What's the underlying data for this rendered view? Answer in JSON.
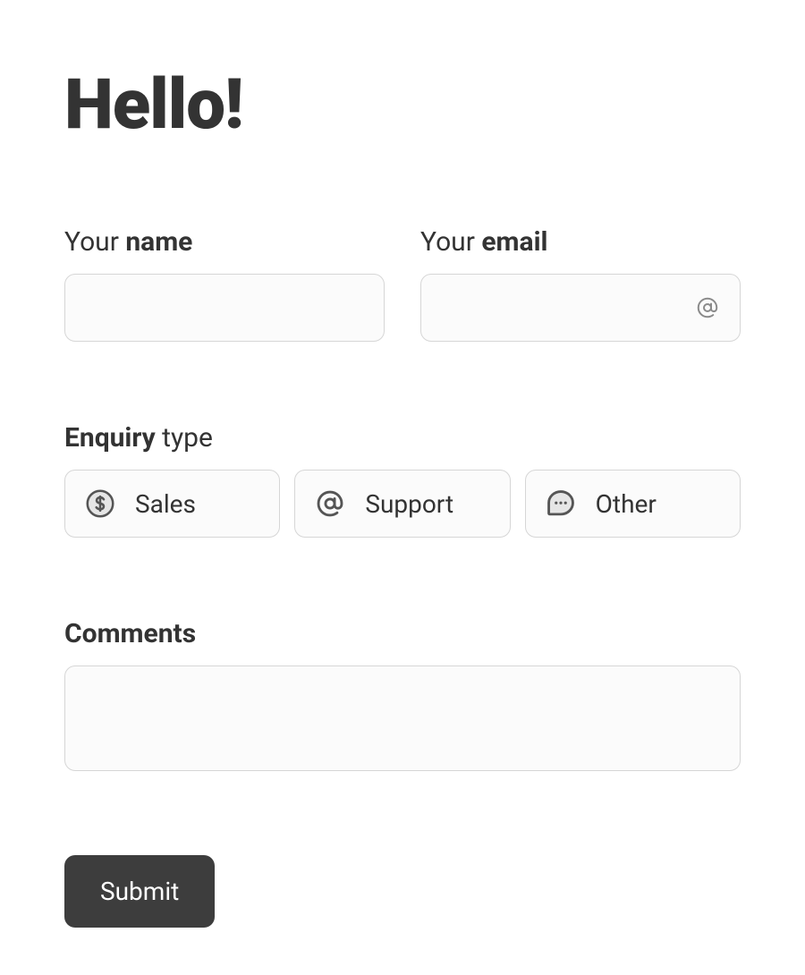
{
  "heading": "Hello!",
  "name_field": {
    "label_light": "Your ",
    "label_bold": "name",
    "value": ""
  },
  "email_field": {
    "label_light": "Your ",
    "label_bold": "email",
    "value": ""
  },
  "enquiry": {
    "label_bold": "Enquiry",
    "label_light": " type",
    "options": [
      {
        "label": "Sales"
      },
      {
        "label": "Support"
      },
      {
        "label": "Other"
      }
    ]
  },
  "comments": {
    "label": "Comments",
    "value": ""
  },
  "submit_label": "Submit"
}
